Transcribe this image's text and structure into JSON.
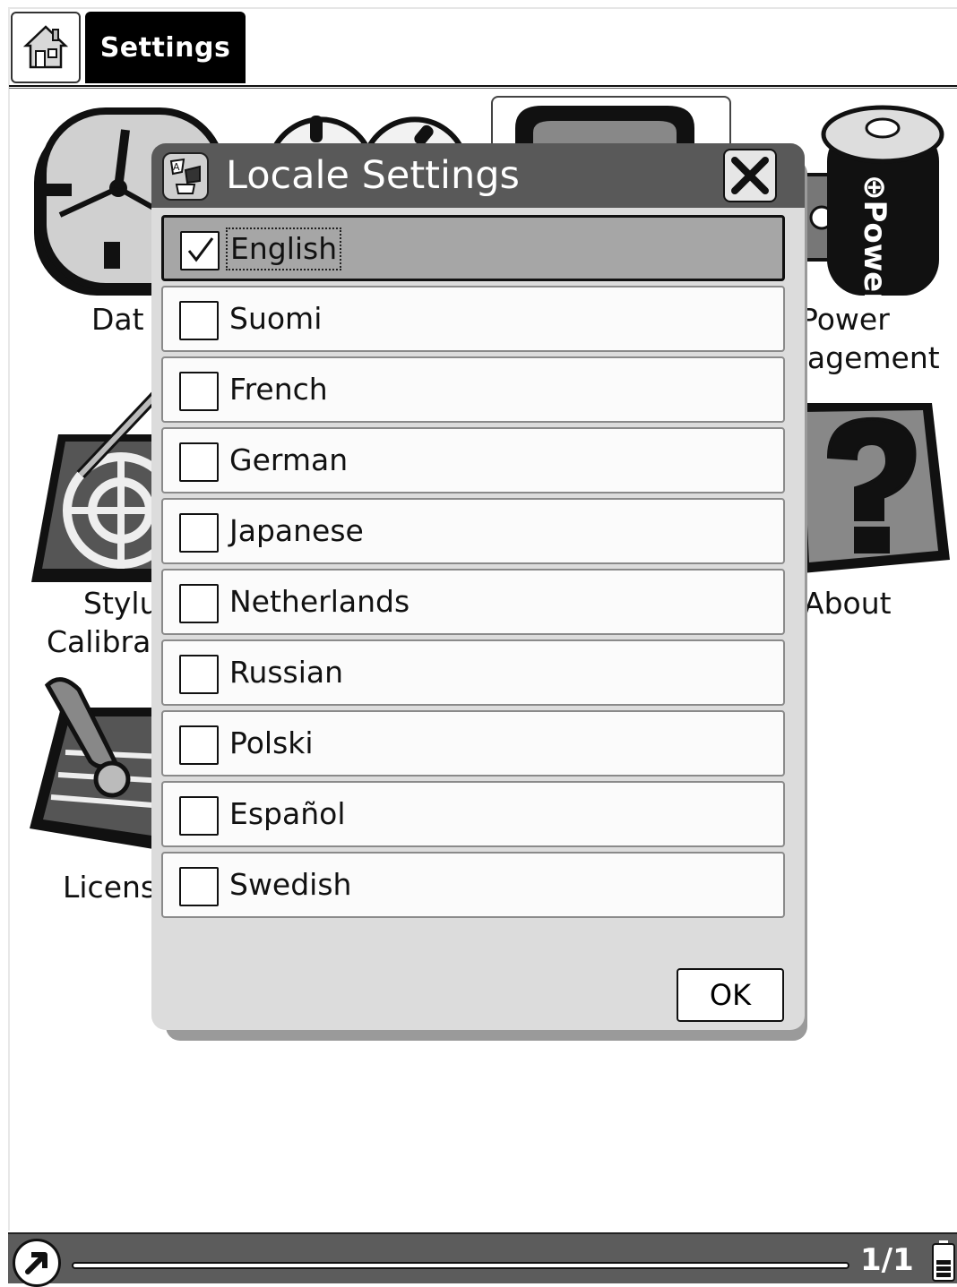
{
  "header": {
    "home_icon": "home-icon",
    "title": "Settings"
  },
  "background_items": [
    {
      "label": "Dat",
      "icon": "clock-icon"
    },
    {
      "label": "Power",
      "label2": "nagement",
      "icon": "power-battery-icon"
    },
    {
      "label": "Stylu",
      "label2": "Calibra",
      "icon": "stylus-target-icon"
    },
    {
      "label": "About",
      "icon": "question-mark-icon"
    },
    {
      "label": "Licens",
      "icon": "license-alert-icon"
    }
  ],
  "dialog": {
    "title": "Locale Settings",
    "close_icon": "close-icon",
    "ok_label": "OK",
    "languages": [
      {
        "label": "English",
        "checked": true
      },
      {
        "label": "Suomi",
        "checked": false
      },
      {
        "label": "French",
        "checked": false
      },
      {
        "label": "German",
        "checked": false
      },
      {
        "label": "Japanese",
        "checked": false
      },
      {
        "label": "Netherlands",
        "checked": false
      },
      {
        "label": "Russian",
        "checked": false
      },
      {
        "label": "Polski",
        "checked": false
      },
      {
        "label": "Español",
        "checked": false
      },
      {
        "label": "Swedish",
        "checked": false
      }
    ]
  },
  "status_bar": {
    "page": "1/1",
    "menu_icon": "arrow-up-right-icon",
    "battery_icon": "battery-icon"
  }
}
